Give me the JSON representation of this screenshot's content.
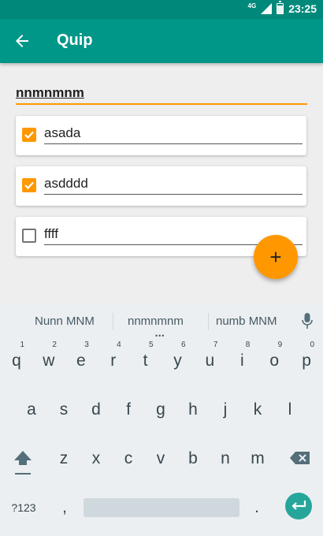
{
  "status_bar": {
    "network": "4G",
    "time": "23:25"
  },
  "app_bar": {
    "title": "Quip"
  },
  "list": {
    "title": "nnmnmnm",
    "items": [
      {
        "text": "asada",
        "checked": true
      },
      {
        "text": "asdddd",
        "checked": true
      },
      {
        "text": "ffff",
        "checked": false
      }
    ]
  },
  "fab": {
    "label": "+"
  },
  "keyboard": {
    "suggestions": [
      "Nunn MNM",
      "nnmnmnm",
      "numb MNM"
    ],
    "row1": [
      {
        "key": "q",
        "hint": "1"
      },
      {
        "key": "w",
        "hint": "2"
      },
      {
        "key": "e",
        "hint": "3"
      },
      {
        "key": "r",
        "hint": "4"
      },
      {
        "key": "t",
        "hint": "5"
      },
      {
        "key": "y",
        "hint": "6"
      },
      {
        "key": "u",
        "hint": "7"
      },
      {
        "key": "i",
        "hint": "8"
      },
      {
        "key": "o",
        "hint": "9"
      },
      {
        "key": "p",
        "hint": "0"
      }
    ],
    "row2": [
      "a",
      "s",
      "d",
      "f",
      "g",
      "h",
      "j",
      "k",
      "l"
    ],
    "row3": [
      "z",
      "x",
      "c",
      "v",
      "b",
      "n",
      "m"
    ],
    "symbols_label": "?123",
    "comma": ",",
    "period": "."
  },
  "colors": {
    "primary": "#009688",
    "primary_dark": "#00897b",
    "accent": "#ff9800"
  }
}
